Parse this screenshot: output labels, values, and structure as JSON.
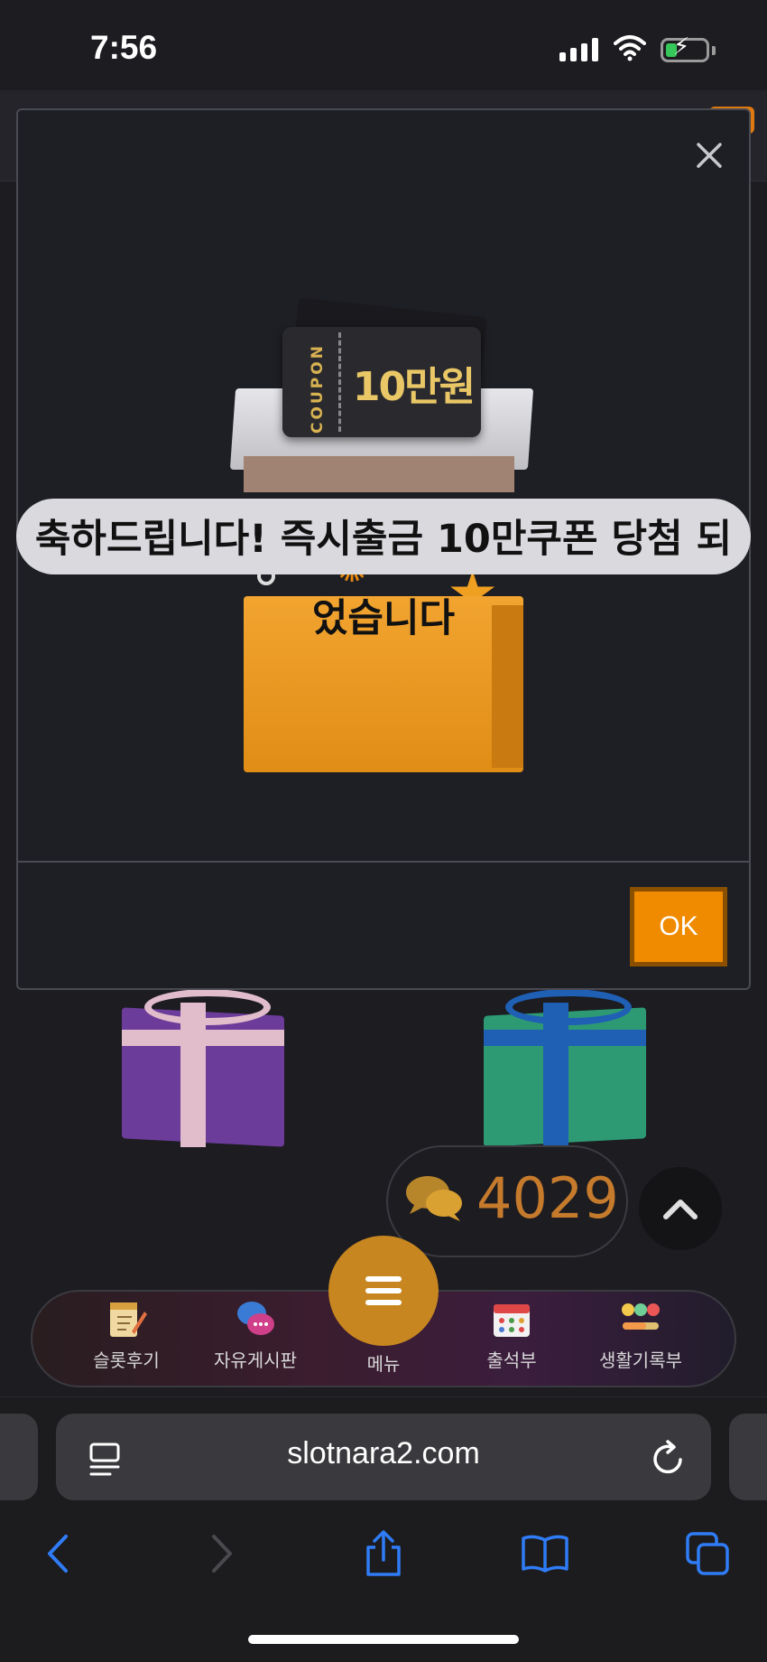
{
  "status_bar": {
    "time": "7:56"
  },
  "modal": {
    "title_line1": "축하드립니다! 즉시출금 10만쿠폰 당첨 되",
    "title_line2": "었습니다",
    "coupon_label": "COUPON",
    "coupon_amount": "10만원",
    "ok_label": "OK"
  },
  "chat": {
    "count": "4029"
  },
  "bottom_nav": {
    "items": [
      {
        "label": "슬롯후기",
        "icon": "notepad-pencil-icon"
      },
      {
        "label": "자유게시판",
        "icon": "chat-bubbles-icon"
      },
      {
        "label": "메뉴",
        "icon": "hamburger-icon"
      },
      {
        "label": "출석부",
        "icon": "calendar-icon"
      },
      {
        "label": "생활기록부",
        "icon": "emoji-bars-icon"
      }
    ]
  },
  "browser": {
    "url": "slotnara2.com"
  },
  "colors": {
    "accent": "#f08b00",
    "background": "#1c1c21",
    "chat_count": "#c57a2c",
    "ios_blue": "#2f7cf6"
  }
}
